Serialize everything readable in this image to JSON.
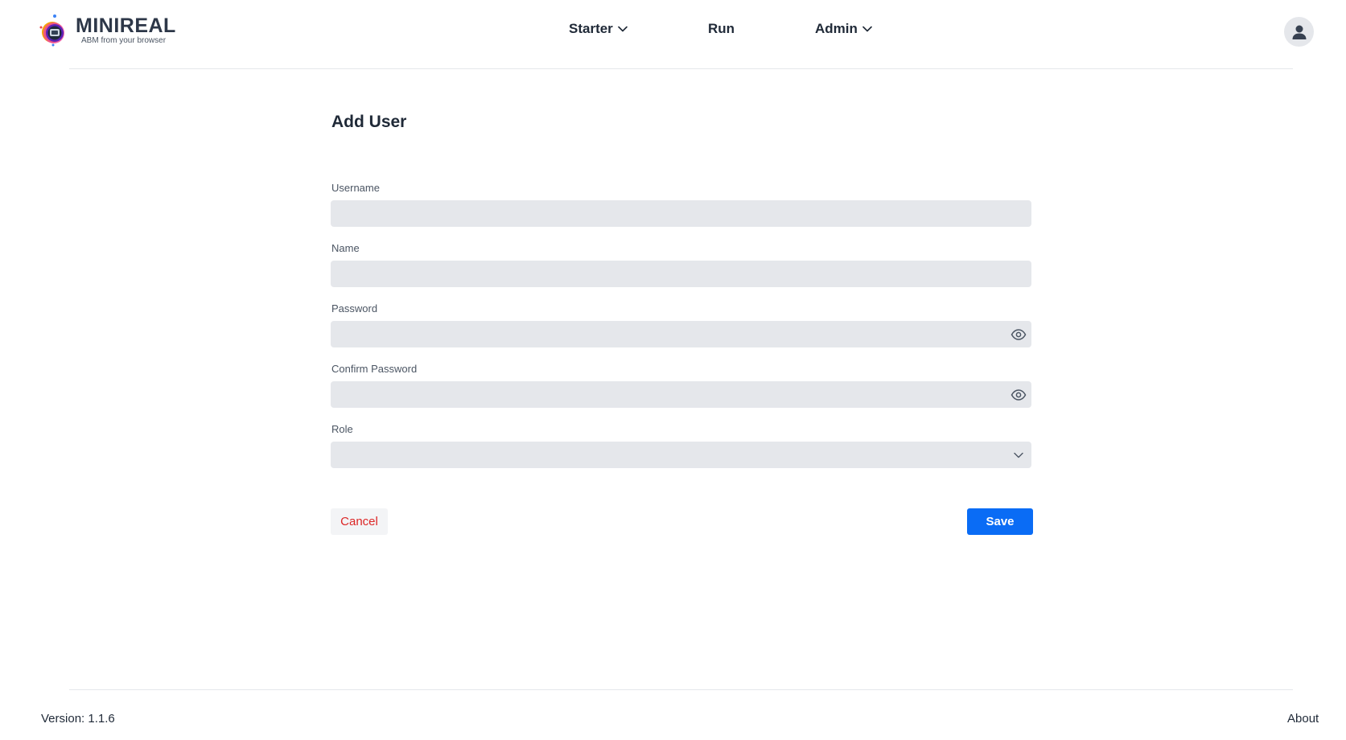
{
  "brand": {
    "title": "MINIREAL",
    "subtitle": "ABM from your browser"
  },
  "nav": {
    "starter": "Starter",
    "run": "Run",
    "admin": "Admin"
  },
  "form": {
    "title": "Add User",
    "fields": {
      "username": {
        "label": "Username",
        "value": "",
        "placeholder": ""
      },
      "name": {
        "label": "Name",
        "value": "",
        "placeholder": ""
      },
      "password": {
        "label": "Password",
        "value": "",
        "placeholder": ""
      },
      "confirm_password": {
        "label": "Confirm Password",
        "value": "",
        "placeholder": ""
      },
      "role": {
        "label": "Role",
        "selected": ""
      }
    },
    "cancel_label": "Cancel",
    "save_label": "Save"
  },
  "footer": {
    "version": "Version: 1.1.6",
    "about": "About"
  },
  "colors": {
    "primary": "#0a6cf5",
    "danger": "#dc2626",
    "field_bg": "#e5e7eb",
    "text": "#1f2937",
    "muted": "#4b5563"
  },
  "icons": {
    "logo": "minireal-logo-icon",
    "nav_dropdown": "chevron-down-icon",
    "avatar": "user-icon",
    "password_toggle": "eye-icon",
    "select_arrow": "chevron-down-icon"
  }
}
